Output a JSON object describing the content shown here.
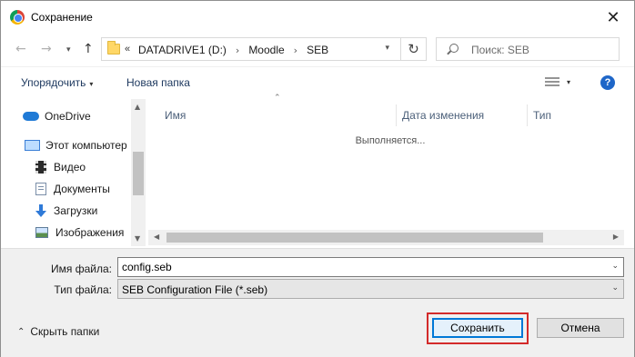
{
  "window": {
    "title": "Сохранение",
    "app_icon": "chrome-icon",
    "close_glyph": "✕"
  },
  "nav": {
    "back_glyph": "←",
    "forward_glyph": "→",
    "recent_glyph": "▾",
    "up_glyph": "↑"
  },
  "address": {
    "overflow": "«",
    "crumbs": [
      "DATADRIVE1 (D:)",
      "Moodle",
      "SEB"
    ],
    "separator": "›",
    "dropdown_glyph": "▾",
    "refresh_glyph": "↻"
  },
  "search": {
    "placeholder": "Поиск: SEB"
  },
  "toolbar": {
    "organize": "Упорядочить",
    "organize_dd": "▾",
    "new_folder": "Новая папка",
    "view_dd": "▾",
    "help": "?"
  },
  "sidebar": {
    "items": [
      {
        "label": "OneDrive",
        "icon": "cloud-icon"
      },
      {
        "label": "Этот компьютер",
        "icon": "computer-icon"
      },
      {
        "label": "Видео",
        "icon": "video-icon"
      },
      {
        "label": "Документы",
        "icon": "documents-icon"
      },
      {
        "label": "Загрузки",
        "icon": "downloads-icon"
      },
      {
        "label": "Изображения",
        "icon": "pictures-icon"
      }
    ]
  },
  "filelist": {
    "sort_glyph": "⌃",
    "columns": [
      "Имя",
      "Дата изменения",
      "Тип"
    ],
    "status": "Выполняется..."
  },
  "form": {
    "file_name_label": "Имя файла:",
    "file_name_value": "config.seb",
    "file_type_label": "Тип файла:",
    "file_type_value": "SEB Configuration File (*.seb)"
  },
  "footer": {
    "hide_folders": "Скрыть папки",
    "hide_glyph": "⌃",
    "save": "Сохранить",
    "cancel": "Отмена"
  },
  "colors": {
    "accent": "#0078d7",
    "highlight": "#d32a2a",
    "help": "#1e66c8"
  }
}
